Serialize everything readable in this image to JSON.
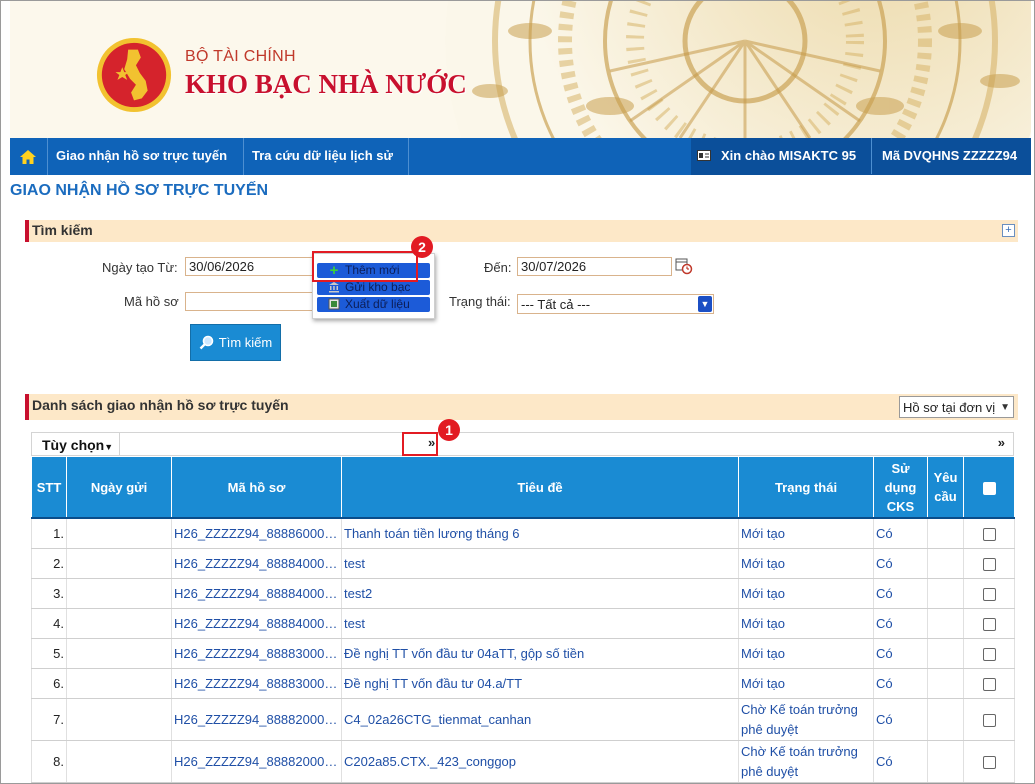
{
  "header": {
    "ministry": "BỘ TÀI CHÍNH",
    "agency": "KHO BẠC NHÀ NƯỚC",
    "logo_icon": "emblem-icon"
  },
  "nav": {
    "home_icon": "home-icon",
    "items": [
      {
        "label": "Giao nhận hồ sơ trực tuyến"
      },
      {
        "label": "Tra cứu dữ liệu lịch sử"
      }
    ],
    "greeting": "Xin chào MISAKTC 95",
    "unit_code": "Mã DVQHNS ZZZZZ94"
  },
  "page_title": "GIAO NHẬN HỒ SƠ TRỰC TUYẾN",
  "search": {
    "section_title": "Tìm kiếm",
    "from_label": "Ngày tạo Từ:",
    "from_value": "30/06/2026",
    "to_label": "Đến:",
    "to_value": "30/07/2026",
    "code_label": "Mã hồ sơ",
    "code_value": "",
    "status_label": "Trạng thái:",
    "status_value": "--- Tất cả ---",
    "search_button": "Tìm kiếm"
  },
  "popup_menu": {
    "items": [
      {
        "label": "Thêm mới",
        "icon": "plus-icon"
      },
      {
        "label": "Gửi kho bạc",
        "icon": "bank-icon"
      },
      {
        "label": "Xuất dữ liệu",
        "icon": "export-icon"
      }
    ]
  },
  "callouts": {
    "one": "1",
    "two": "2"
  },
  "list": {
    "section_title": "Danh sách giao nhận hồ sơ trực tuyến",
    "filter_value": "Hồ sơ tại đơn vị",
    "options_label": "Tùy chọn",
    "expand_glyph": "»",
    "columns": [
      "STT",
      "Ngày gửi",
      "Mã hồ sơ",
      "Tiêu đề",
      "Trạng thái",
      "Sử dụng CKS",
      "Yêu cầu"
    ],
    "rows": [
      {
        "stt": "1.",
        "date": "",
        "code": "H26_ZZZZZ94_8888600000…",
        "title": "Thanh toán tiền lương tháng 6",
        "status": "Mới tạo",
        "cks": "Có",
        "req": ""
      },
      {
        "stt": "2.",
        "date": "",
        "code": "H26_ZZZZZ94_8888400000…",
        "title": "test",
        "status": "Mới tạo",
        "cks": "Có",
        "req": ""
      },
      {
        "stt": "3.",
        "date": "",
        "code": "H26_ZZZZZ94_8888400000…",
        "title": "test2",
        "status": "Mới tạo",
        "cks": "Có",
        "req": ""
      },
      {
        "stt": "4.",
        "date": "",
        "code": "H26_ZZZZZ94_8888400000…",
        "title": "test",
        "status": "Mới tạo",
        "cks": "Có",
        "req": ""
      },
      {
        "stt": "5.",
        "date": "",
        "code": "H26_ZZZZZ94_8888300000…",
        "title": "Đề nghị TT vốn đầu tư 04aTT, gộp số tiền",
        "status": "Mới tạo",
        "cks": "Có",
        "req": ""
      },
      {
        "stt": "6.",
        "date": "",
        "code": "H26_ZZZZZ94_8888300000…",
        "title": "Đề nghị TT vốn đầu tư 04.a/TT",
        "status": "Mới tạo",
        "cks": "Có",
        "req": ""
      },
      {
        "stt": "7.",
        "date": "",
        "code": "H26_ZZZZZ94_8888200000…",
        "title": "C4_02a26CTG_tienmat_canhan",
        "status": "Chờ Kế toán trưởng phê duyệt",
        "cks": "Có",
        "req": ""
      },
      {
        "stt": "8.",
        "date": "",
        "code": "H26_ZZZZZ94_8888200000…",
        "title": "C202a85.CTX._423_conggop",
        "status": "Chờ Kế toán trưởng phê duyệt",
        "cks": "Có",
        "req": ""
      }
    ]
  },
  "colors": {
    "nav_blue": "#0f63b8",
    "header_blue": "#1a8bd3",
    "accent_red": "#c8102e",
    "section_bg": "#fde8c8",
    "link_blue": "#1f4fa6"
  }
}
